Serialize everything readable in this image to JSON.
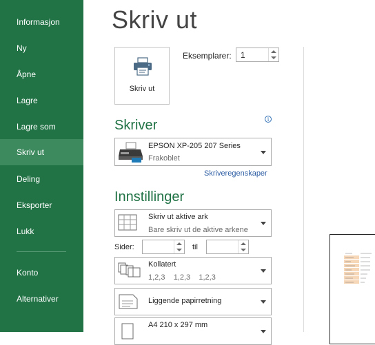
{
  "sidebar": {
    "items": [
      {
        "label": "Informasjon"
      },
      {
        "label": "Ny"
      },
      {
        "label": "Åpne"
      },
      {
        "label": "Lagre"
      },
      {
        "label": "Lagre som"
      },
      {
        "label": "Skriv ut"
      },
      {
        "label": "Deling"
      },
      {
        "label": "Eksporter"
      },
      {
        "label": "Lukk"
      },
      {
        "label": "Konto"
      },
      {
        "label": "Alternativer"
      }
    ],
    "active": "Skriv ut"
  },
  "main": {
    "title": "Skriv ut",
    "print_button": {
      "label": "Skriv ut",
      "icon": "printer-icon"
    },
    "copies": {
      "label": "Eksemplarer:",
      "value": "1"
    },
    "printer": {
      "section_title": "Skriver",
      "name": "EPSON XP-205 207 Series",
      "status": "Frakoblet",
      "properties_link": "Skriveregenskaper"
    },
    "settings": {
      "section_title": "Innstillinger",
      "what_to_print": {
        "title": "Skriv ut aktive ark",
        "subtitle": "Bare skriv ut de aktive arkene"
      },
      "pages": {
        "label": "Sider:",
        "to_label": "til",
        "from": "",
        "to": ""
      },
      "collation": {
        "title": "Kollatert",
        "subtitle": "1,2,3    1,2,3    1,2,3"
      },
      "orientation": {
        "title": "Liggende papirretning"
      },
      "paper": {
        "title": "A4 210 x 297 mm"
      }
    }
  },
  "colors": {
    "accent": "#217346",
    "sidebar_active": "#3d8a5f",
    "link": "#2f5fa5"
  }
}
